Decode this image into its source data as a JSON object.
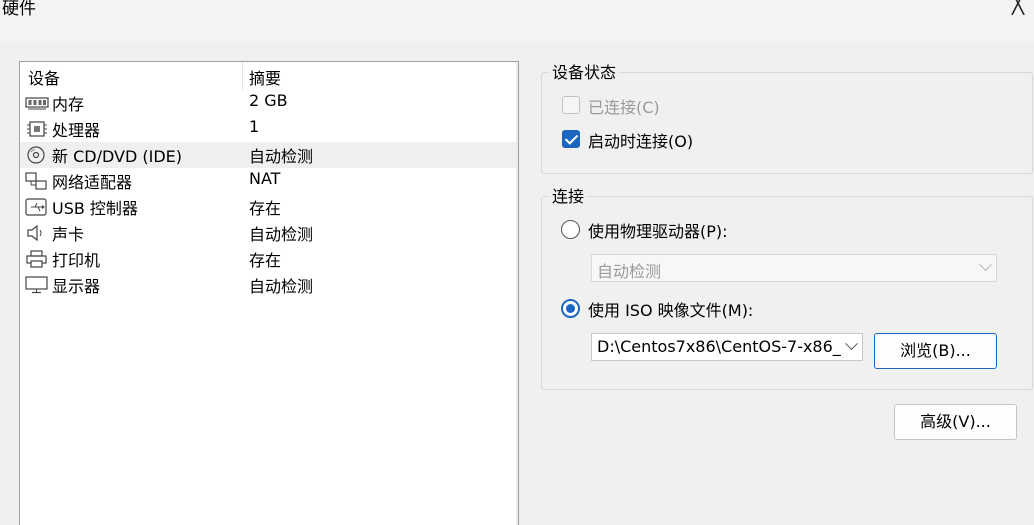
{
  "window": {
    "title": "硬件",
    "close_glyph": "╳"
  },
  "device_list": {
    "header": {
      "device": "设备",
      "summary": "摘要"
    },
    "items": [
      {
        "name": "内存",
        "summary": "2 GB",
        "icon": "memory-icon"
      },
      {
        "name": "处理器",
        "summary": "1",
        "icon": "processor-icon"
      },
      {
        "name": "新 CD/DVD (IDE)",
        "summary": "自动检测",
        "icon": "cd-dvd-icon"
      },
      {
        "name": "网络适配器",
        "summary": "NAT",
        "icon": "network-adapter-icon"
      },
      {
        "name": "USB 控制器",
        "summary": "存在",
        "icon": "usb-icon"
      },
      {
        "name": "声卡",
        "summary": "自动检测",
        "icon": "speaker-icon"
      },
      {
        "name": "打印机",
        "summary": "存在",
        "icon": "printer-icon"
      },
      {
        "name": "显示器",
        "summary": "自动检测",
        "icon": "display-icon"
      }
    ],
    "selected": "新 CD/DVD (IDE)"
  },
  "device_status": {
    "title": "设备状态",
    "connected": {
      "label": "已连接(C)",
      "checked": false,
      "enabled": false
    },
    "connect_at_power_on": {
      "label": "启动时连接(O)",
      "checked": true
    }
  },
  "connection": {
    "title": "连接",
    "physical_drive": {
      "label": "使用物理驱动器(P):",
      "selected": false,
      "combo_value": "自动检测"
    },
    "iso_image": {
      "label": "使用 ISO 映像文件(M):",
      "selected": true,
      "path": "D:\\Centos7x86\\CentOS-7-x86_",
      "browse_label": "浏览(B)..."
    }
  },
  "advanced_label": "高级(V)...",
  "colors": {
    "accent": "#1a66c0",
    "background": "#f0f0f0",
    "selected_row": "#efefef"
  }
}
